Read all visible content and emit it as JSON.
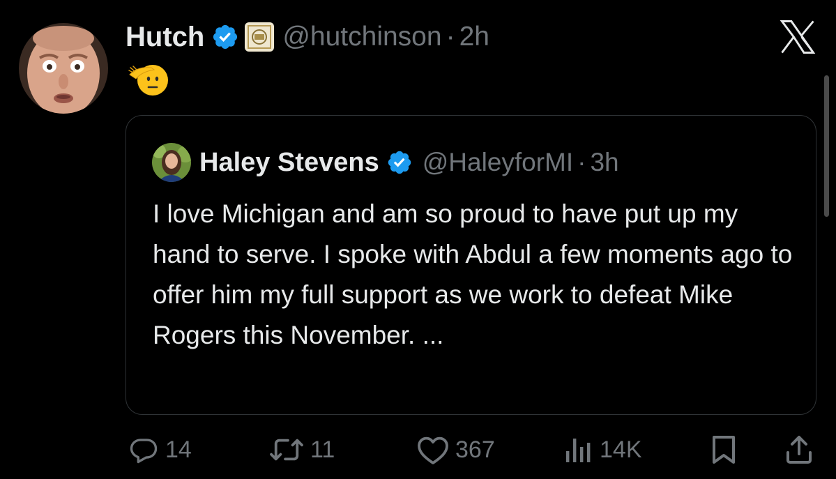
{
  "tweet": {
    "author_name": "Hutch",
    "handle": "@hutchinson",
    "separator": "·",
    "time": "2h",
    "body_emoji": "🫡"
  },
  "quote": {
    "author_name": "Haley Stevens",
    "handle": "@HaleyforMI",
    "separator": "·",
    "time": "3h",
    "text": "I love Michigan and am so proud to have put up my hand to serve. I spoke with Abdul a few moments ago to offer him my full support as we work to defeat Mike Rogers this November. ..."
  },
  "actions": {
    "replies": "14",
    "reposts": "11",
    "likes": "367",
    "views": "14K"
  },
  "icons": {
    "verified": "verified-badge-icon",
    "x_logo": "x-logo-icon",
    "reply": "reply-icon",
    "repost": "repost-icon",
    "like": "heart-icon",
    "views": "views-icon",
    "bookmark": "bookmark-icon",
    "share": "share-icon"
  },
  "colors": {
    "background": "#000000",
    "primary_text": "#e7e9ea",
    "secondary_text": "#71767b",
    "verified_blue": "#1d9bf0",
    "border": "#2f3336"
  }
}
